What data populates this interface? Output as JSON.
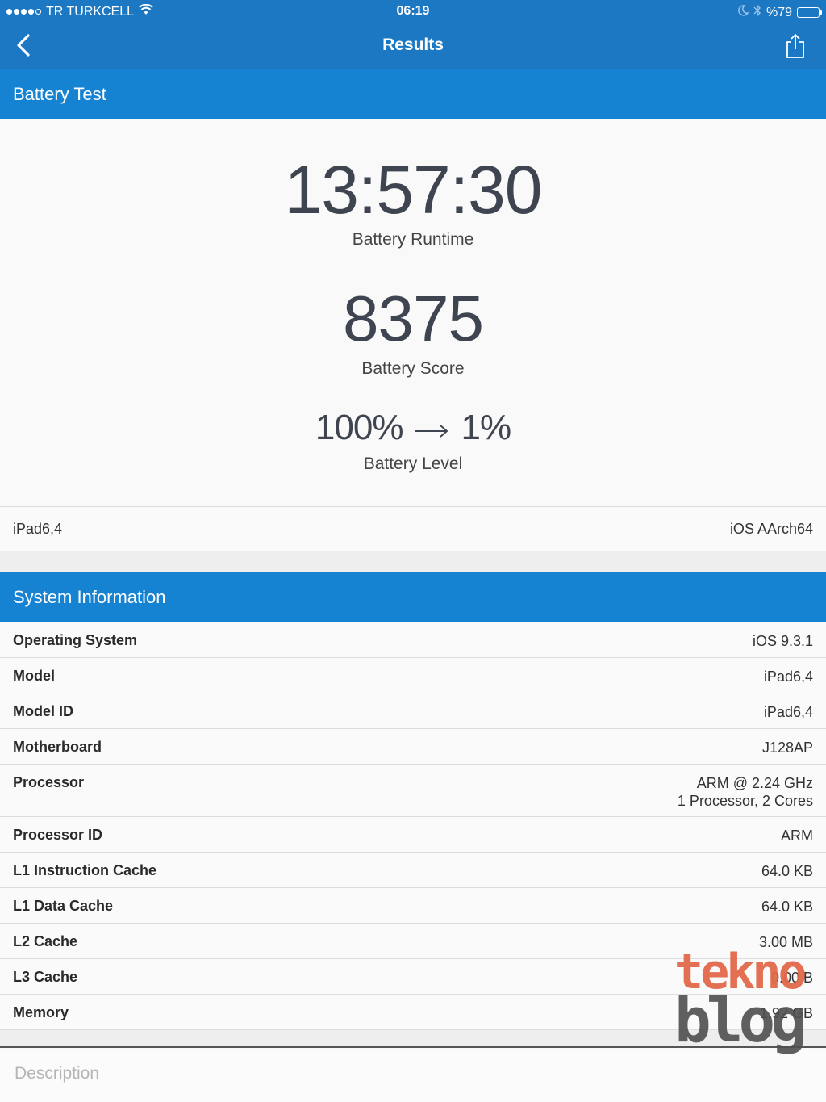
{
  "status_bar": {
    "carrier": "TR TURKCELL",
    "time": "06:19",
    "battery_percent": "%79",
    "battery_level": 0.79,
    "icons": [
      "signal-dots",
      "wifi-icon",
      "moon-icon",
      "bluetooth-icon",
      "battery-icon"
    ]
  },
  "nav": {
    "title": "Results",
    "back_icon": "chevron-left-icon",
    "share_icon": "share-icon"
  },
  "battery_section": {
    "header": "Battery Test",
    "runtime": {
      "value": "13:57:30",
      "label": "Battery Runtime"
    },
    "score": {
      "value": "8375",
      "label": "Battery Score"
    },
    "level": {
      "start": "100%",
      "end": "1%",
      "label": "Battery Level"
    },
    "device": {
      "model": "iPad6,4",
      "platform": "iOS AArch64"
    }
  },
  "system_info": {
    "header": "System Information",
    "rows": [
      {
        "key": "Operating System",
        "value": "iOS 9.3.1"
      },
      {
        "key": "Model",
        "value": "iPad6,4"
      },
      {
        "key": "Model ID",
        "value": "iPad6,4"
      },
      {
        "key": "Motherboard",
        "value": "J128AP"
      },
      {
        "key": "Processor",
        "value": "ARM @ 2.24 GHz",
        "value2": "1 Processor, 2 Cores"
      },
      {
        "key": "Processor ID",
        "value": "ARM"
      },
      {
        "key": "L1 Instruction Cache",
        "value": "64.0 KB"
      },
      {
        "key": "L1 Data Cache",
        "value": "64.0 KB"
      },
      {
        "key": "L2 Cache",
        "value": "3.00 MB"
      },
      {
        "key": "L3 Cache",
        "value": "0.00 B"
      },
      {
        "key": "Memory",
        "value": "1.92 GB"
      }
    ]
  },
  "description": {
    "label": "Description"
  },
  "watermark": {
    "top": "tekno",
    "bottom": "blog"
  },
  "colors": {
    "nav_bg": "#1d78c4",
    "section_bg": "#1682d2",
    "watermark_accent": "#e2694a"
  }
}
